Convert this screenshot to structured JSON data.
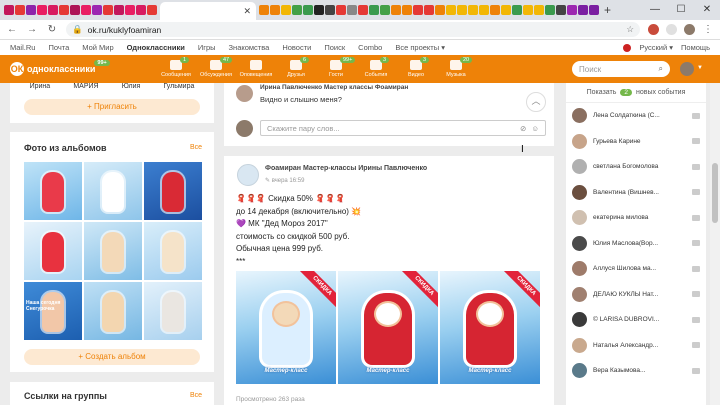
{
  "browser": {
    "tab_label": "",
    "url": "ok.ru/kuklyfoamiran",
    "tab_favicon_colors": [
      "#c2185b",
      "#e53935",
      "#8e24aa",
      "#e91e63",
      "#d81b60",
      "#e53935",
      "#ad1457",
      "#e91e63",
      "#9c27b0",
      "#e53935",
      "#c2185b",
      "#e91e63",
      "#d81b60",
      "#e53935"
    ],
    "tab_favicon_colors_right": [
      "#ee8208",
      "#ee8208",
      "#f2b705",
      "#43a047",
      "#3a9a4d",
      "#222",
      "#444",
      "#e53935",
      "#888",
      "#e53935",
      "#3a9a4d",
      "#43a047",
      "#ee8208",
      "#ee8208",
      "#e53935",
      "#e53935",
      "#ee8208",
      "#f2b705",
      "#f2b705",
      "#f2b705",
      "#f2b705",
      "#ee8208",
      "#f2b705",
      "#3a9a4d",
      "#f2b705",
      "#f2b705",
      "#3a9a4d",
      "#444",
      "#9c27b0",
      "#7b1fa2",
      "#7b1fa2"
    ]
  },
  "portal": {
    "links": [
      "Mail.Ru",
      "Почта",
      "Мой Мир",
      "Одноклассники",
      "Игры",
      "Знакомства",
      "Новости",
      "Поиск",
      "Combo",
      "Все проекты ▾"
    ],
    "language": "Русский ▾",
    "help": "Помощь"
  },
  "ok_header": {
    "logo_text": "одноклассники",
    "logo_badge": "99+",
    "nav": [
      {
        "label": "Сообщения",
        "count": "1"
      },
      {
        "label": "Обсуждения",
        "count": "47"
      },
      {
        "label": "Оповещения",
        "count": ""
      },
      {
        "label": "Друзья",
        "count": "6"
      },
      {
        "label": "Гости",
        "count": "99+"
      },
      {
        "label": "События",
        "count": "3"
      },
      {
        "label": "Видео",
        "count": "3"
      },
      {
        "label": "Музыка",
        "count": "20"
      }
    ],
    "search_placeholder": "Поиск"
  },
  "left": {
    "friends": [
      "Ирина",
      "МАРИЯ",
      "Юлия",
      "Гульмира"
    ],
    "invite_label": "+ Пригласить",
    "photos_title": "Фото из альбомов",
    "all_label": "Все",
    "create_album_label": "+ Создать альбом",
    "groups_title": "Ссылки на группы",
    "groups_all_label": "Все",
    "photo_captions": [
      "",
      "",
      "",
      "",
      "",
      "",
      "Наша сегодня Снегурочка",
      "",
      ""
    ]
  },
  "comment": {
    "author": "Ирина Павлюченко Мастер классы Фоамиран",
    "text": "Видно и слышно меня?",
    "input_placeholder": "Скажите пару слов..."
  },
  "post": {
    "author": "Фоамиран Мастер-классы Ирины Павлюченко",
    "time": "вчера 16:59",
    "lines": [
      "🧣🧣🧣 Скидка 50% 🧣🧣🧣",
      "до 14 декабря (включительно) 💥",
      "💜 МК \"Дед Мороз 2017\"",
      "стоимость со скидкой 500 руб.",
      "Обычная цена 999 руб.",
      "***"
    ],
    "image_ribbon": "СКИДКА",
    "image_caption": "Мастер-класс",
    "views": "Просмотрено 263 раза"
  },
  "events": {
    "show_label": "Показать",
    "count": "2",
    "suffix": "новых события",
    "people": [
      "Лена Солдаткина (С...",
      "Гурьева Карине",
      "светлана Богомолова",
      "Валентина (Вишнев...",
      "екатерина милова",
      "Юлия Маслова(Вор...",
      "Аллуся Шилова ма...",
      "ДЕЛАЮ КУКЛЫ Нат...",
      "© LARISA DUBROVI...",
      "Наталья Александр...",
      "Вера Казымова..."
    ],
    "avatar_colors": [
      "#8a6f60",
      "#c7a48a",
      "#b0b0b0",
      "#6b4f3f",
      "#d0c0b0",
      "#4a4a4a",
      "#9e7b6a",
      "#a08070",
      "#3a3a3a",
      "#c9a98e",
      "#5a7a8a"
    ]
  }
}
